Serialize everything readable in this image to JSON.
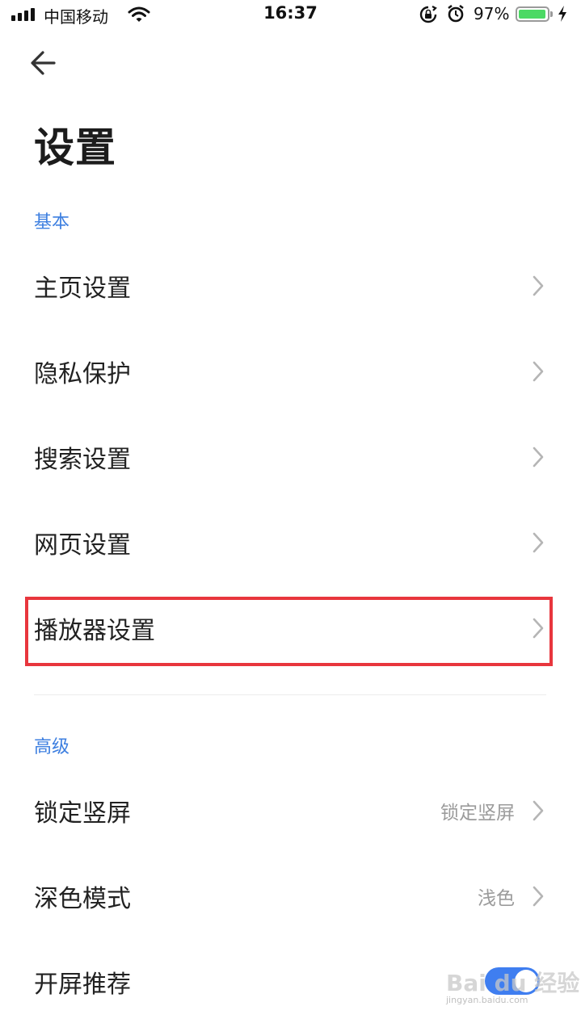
{
  "status_bar": {
    "carrier": "中国移动",
    "time": "16:37",
    "battery_percent": "97%",
    "battery_level": 0.97,
    "icons": [
      "signal-icon",
      "wifi-icon",
      "orientation-lock-icon",
      "alarm-icon",
      "battery-icon",
      "charging-bolt-icon"
    ]
  },
  "nav": {
    "back_icon": "arrow-left-icon"
  },
  "page": {
    "title": "设置"
  },
  "sections": {
    "basic": {
      "header": "基本",
      "items": [
        {
          "label": "主页设置"
        },
        {
          "label": "隐私保护"
        },
        {
          "label": "搜索设置"
        },
        {
          "label": "网页设置"
        },
        {
          "label": "播放器设置",
          "highlighted": true
        }
      ]
    },
    "advanced": {
      "header": "高级",
      "items": [
        {
          "label": "锁定竖屏",
          "value": "锁定竖屏"
        },
        {
          "label": "深色模式",
          "value": "浅色"
        },
        {
          "label": "开屏推荐",
          "toggle_on": true
        }
      ]
    }
  },
  "watermark": {
    "brand": "Bai du 经验",
    "url": "jingyan.baidu.com"
  },
  "colors": {
    "accent": "#3d7fe0",
    "highlight_border": "#e8363d",
    "toggle_on": "#3f7ef0",
    "battery_fill": "#4cd964"
  }
}
